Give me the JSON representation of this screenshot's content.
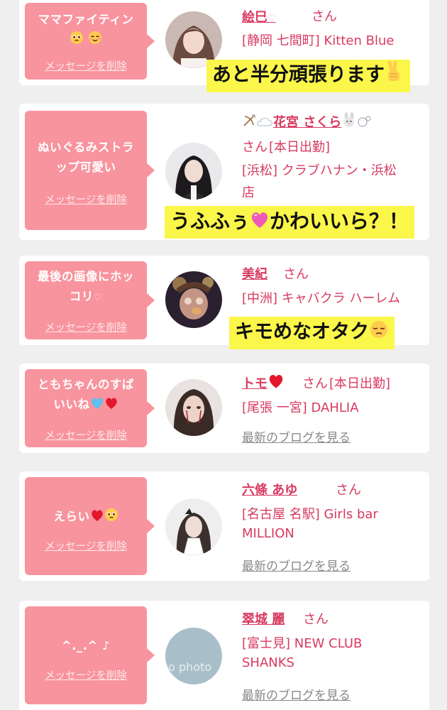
{
  "cards": [
    {
      "message": "ママファイティン",
      "message_emoji": [
        "pleading-face-icon",
        "smiling-face-icon"
      ],
      "delete_label": "メッセージを削除",
      "name": "絵巳",
      "name_suffix_icon": "heart-outline-icon",
      "honorific": "さん",
      "location": "[静岡 七間町] Kitten Blue",
      "caption": "あと半分頑張ります",
      "caption_emoji": "victory-hand-icon"
    },
    {
      "message_line1": "ぬいぐるみストラ",
      "message_line2": "ップ可愛い",
      "delete_label": "メッセージを削除",
      "name_prefix_icons": [
        "bow-arrow-icon",
        "cloud-icon"
      ],
      "name": "花宮 さくら",
      "name_suffix_icons": [
        "rabbit-icon",
        "bubbles-icon"
      ],
      "honorific": "さん",
      "status": "[本日出勤]",
      "location_line1": "[浜松] クラブハナン・浜松",
      "location_line2": "店",
      "caption_part1": "うふふぅ",
      "caption_emoji": "pink-heart-icon",
      "caption_part2": "かわいいら？！"
    },
    {
      "message_line1": "最後の画像にホッ",
      "message_line2": "コリ",
      "message_suffix_icon": "heart-outline-icon",
      "delete_label": "メッセージを削除",
      "name": "美紀",
      "honorific": "さん",
      "location": "[中洲] キャバクラ ハーレム",
      "caption": "キモめなオタク",
      "caption_emoji": "pensive-face-icon"
    },
    {
      "message_line1": "ともちゃんのすば",
      "message_line2": "いいね",
      "message_emoji": [
        "blue-heart-icon",
        "red-heart-icon"
      ],
      "delete_label": "メッセージを削除",
      "name": "トモ",
      "name_suffix_icon": "red-heart-icon",
      "honorific": "さん",
      "status": "[本日出勤]",
      "location": "[尾張 一宮] DAHLIA",
      "blog_link": "最新のブログを見る"
    },
    {
      "message": "えらい",
      "message_emoji": [
        "red-heart-icon",
        "pleading-face-icon"
      ],
      "delete_label": "メッセージを削除",
      "name": "六條 あゆ",
      "honorific": "さん",
      "location_line1": "[名古屋 名駅] Girls bar",
      "location_line2": "MILLION",
      "blog_link": "最新のブログを見る"
    },
    {
      "message": "^._.^ ♪",
      "delete_label": "メッセージを削除",
      "name": "翠城 麗",
      "honorific": "さん",
      "location_line1": "[富士見] NEW CLUB",
      "location_line2": "SHANKS",
      "avatar_text": "no photo",
      "blog_link": "最新のブログを見る"
    }
  ],
  "colors": {
    "page_bg": "#efefef",
    "bubble": "#f8949e",
    "name": "#d83a60",
    "caption_bg": "#fbf64a"
  }
}
